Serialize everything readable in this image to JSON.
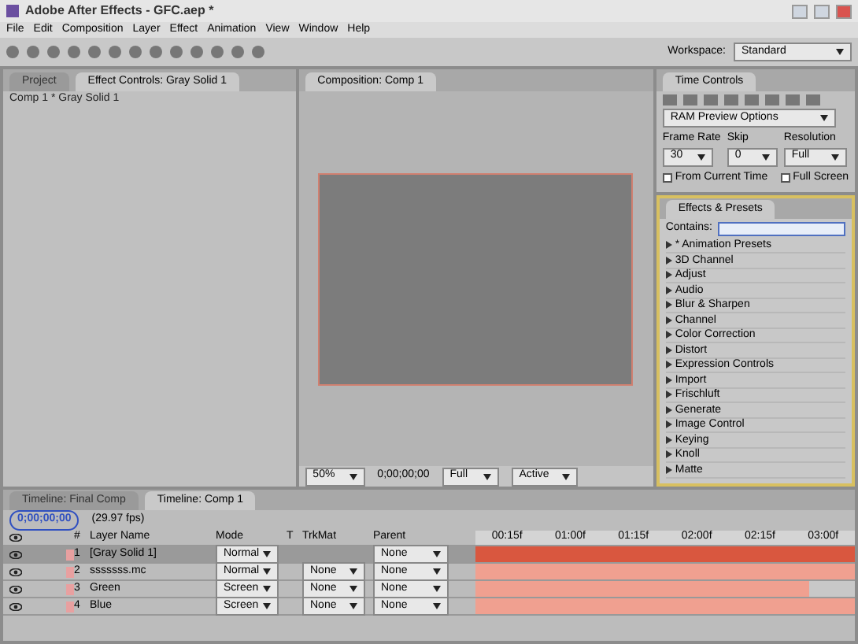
{
  "window": {
    "title": "Adobe After Effects - GFC.aep *"
  },
  "menu": [
    "File",
    "Edit",
    "Composition",
    "Layer",
    "Effect",
    "Animation",
    "View",
    "Window",
    "Help"
  ],
  "workspace": {
    "label": "Workspace:",
    "value": "Standard"
  },
  "left_panel": {
    "tabs": [
      {
        "label": "Project",
        "selected": false
      },
      {
        "label": "Effect Controls: Gray Solid 1",
        "selected": true
      }
    ],
    "subtitle": "Comp 1 * Gray Solid 1"
  },
  "composition": {
    "tab": "Composition: Comp 1",
    "zoom": "50%",
    "timecode": "0;00;00;00",
    "resolution": "Full",
    "view": "Active"
  },
  "time_controls": {
    "tab": "Time Controls",
    "preview": "RAM Preview Options",
    "fields": [
      {
        "label": "Frame Rate",
        "value": "30"
      },
      {
        "label": "Skip",
        "value": "0"
      },
      {
        "label": "Resolution",
        "value": "Full"
      }
    ],
    "checks": [
      {
        "label": "From Current Time",
        "checked": false
      },
      {
        "label": "Full Screen",
        "checked": false
      }
    ]
  },
  "effects": {
    "tab": "Effects & Presets",
    "search_label": "Contains:",
    "items": [
      "* Animation Presets",
      "3D Channel",
      "Adjust",
      "Audio",
      "Blur & Sharpen",
      "Channel",
      "Color Correction",
      "Distort",
      "Expression Controls",
      "Import",
      "Frischluft",
      "Generate",
      "Image Control",
      "Keying",
      "Knoll",
      "Matte"
    ]
  },
  "timeline": {
    "tabs": [
      {
        "label": "Timeline: Final Comp",
        "selected": false
      },
      {
        "label": "Timeline: Comp 1",
        "selected": true
      }
    ],
    "timecode": "0;00;00;00",
    "fps": "(29.97 fps)",
    "columns": [
      "#",
      "Layer Name",
      "Mode",
      "T",
      "TrkMat",
      "Parent"
    ],
    "ticks": [
      "00:15f",
      "01:00f",
      "01:15f",
      "02:00f",
      "02:15f",
      "03:00f"
    ],
    "layers": [
      {
        "number": "1",
        "name": "[Gray Solid 1]",
        "mode": "Normal",
        "parent": "None",
        "selected": true,
        "level": 1
      },
      {
        "number": "2",
        "name": "sssssss.mc",
        "mode": "Normal",
        "trkmat": "None",
        "parent": "None",
        "selected": false,
        "level": 1
      },
      {
        "number": "3",
        "name": "Green",
        "mode": "Screen",
        "trkmat": "None",
        "parent": "None",
        "selected": false,
        "level": 0.88
      },
      {
        "number": "4",
        "name": "Blue",
        "mode": "Screen",
        "trkmat": "None",
        "parent": "None",
        "selected": false,
        "level": 1
      }
    ]
  }
}
